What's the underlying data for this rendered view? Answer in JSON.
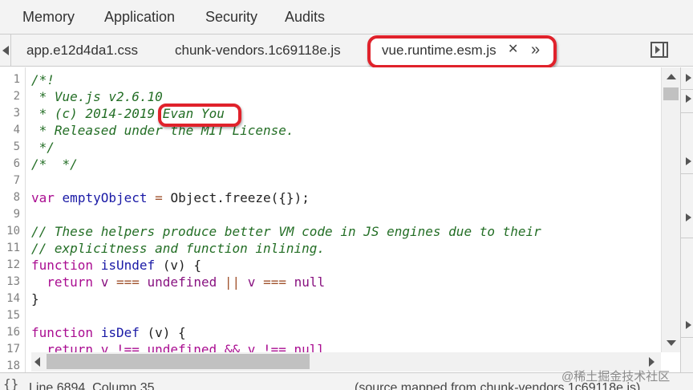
{
  "panel_tabs": [
    "Memory",
    "Application",
    "Security",
    "Audits"
  ],
  "file_tabs": {
    "items": [
      "app.e12d4da1.css",
      "chunk-vendors.1c69118e.js",
      "vue.runtime.esm.js"
    ],
    "close_glyph": "✕",
    "more_glyph": "»"
  },
  "editor": {
    "line_numbers": [
      "1",
      "2",
      "3",
      "4",
      "5",
      "6",
      "7",
      "8",
      "9",
      "10",
      "11",
      "12",
      "13",
      "14",
      "15",
      "16",
      "17",
      "18"
    ],
    "code": {
      "l1": "/*!",
      "l2": " * Vue.js v2.6.10",
      "l3a": " * (c) 2014-2019 ",
      "l3b": "Evan You",
      "l4": " * Released under the MIT License.",
      "l5": " */",
      "l6": "/*  */",
      "l8_kw": "var",
      "l8_def": "emptyObject",
      "l8_op": "=",
      "l8_rest": "Object.freeze({});",
      "l10": "// These helpers produce better VM code in JS engines due to their",
      "l11": "// explicitness and function inlining.",
      "l12_kw": "function",
      "l12_def": "isUndef",
      "l12_rest": "(v) {",
      "l13_kw": "return",
      "l13_a": "v",
      "l13_op1": "===",
      "l13_b": "undefined",
      "l13_op2": "||",
      "l13_c": "v",
      "l13_op3": "===",
      "l13_d": "null",
      "l14": "}",
      "l16_kw": "function",
      "l16_def": "isDef",
      "l16_rest": "(v) {",
      "l17": "  return v !== undefined && v !== null"
    }
  },
  "status_bar": {
    "position": "Line 6894, Column 35",
    "source_map": "(source mapped from chunk-vendors.1c69118e.js)"
  },
  "watermark": "@稀土掘金技术社区",
  "colors": {
    "highlight": "#e0222b",
    "comment": "#236e25",
    "keyword": "#aa0d91"
  }
}
